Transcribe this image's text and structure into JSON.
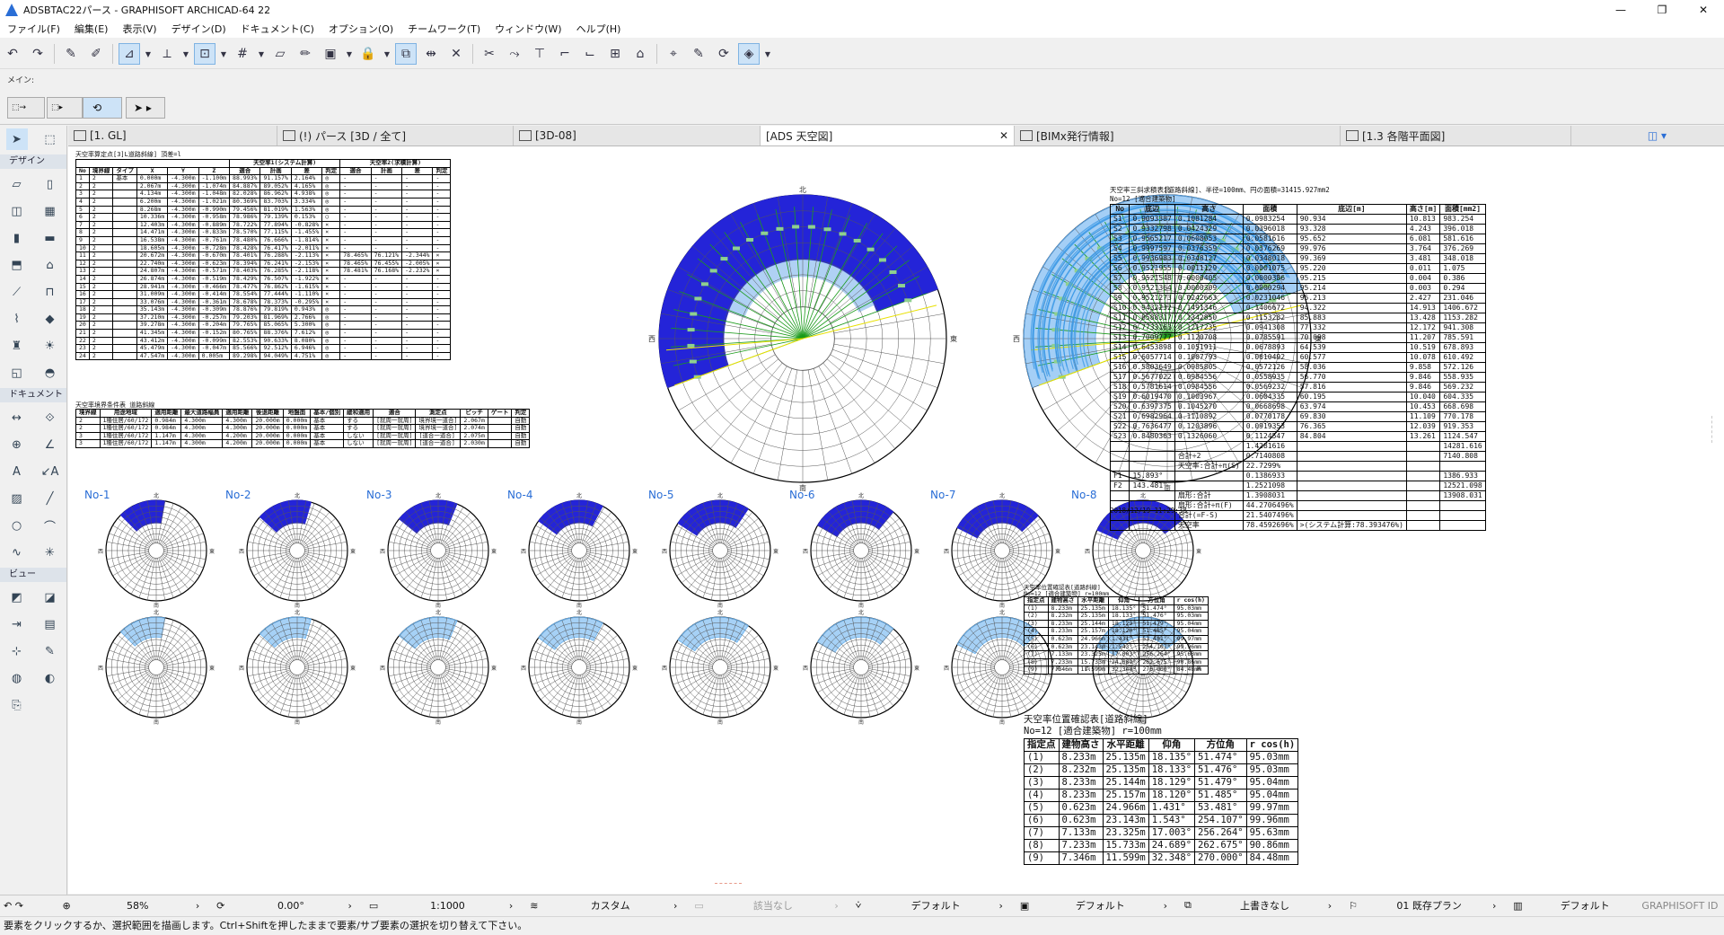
{
  "window": {
    "title": "ADSBTAC22パース - GRAPHISOFT ARCHICAD-64 22",
    "min": "—",
    "max": "❐",
    "close": "✕"
  },
  "menu": [
    "ファイル(F)",
    "編集(E)",
    "表示(V)",
    "デザイン(D)",
    "ドキュメント(C)",
    "オプション(O)",
    "チームワーク(T)",
    "ウィンドウ(W)",
    "ヘルプ(H)"
  ],
  "infobox": {
    "label": "メイン:"
  },
  "toolbox": {
    "design": "デザイン",
    "document": "ドキュメント",
    "view": "ビュー"
  },
  "tabs": [
    {
      "label": "[1. GL]",
      "active": false
    },
    {
      "label": "(!) パース [3D / 全て]",
      "active": false
    },
    {
      "label": "[3D-08]",
      "active": false
    },
    {
      "label": "[ADS 天空図]",
      "active": true
    },
    {
      "label": "[BIMx発行情報]",
      "active": false
    },
    {
      "label": "[1.3 各階平面図]",
      "active": false
    }
  ],
  "tab_close": "✕",
  "canvas": {
    "table1_title": "天空率算定点[3]L道路斜線] 頂差=l",
    "table1_group1": "天空率1(システム計算)",
    "table1_group2": "天空率2(求積計算)",
    "table1_headers": [
      "No",
      "境界線",
      "タイプ",
      "X",
      "Y",
      "Z",
      "適合",
      "計画",
      "差",
      "判定",
      "適合",
      "計画",
      "差",
      "判定"
    ],
    "table1_rows": [
      [
        "1",
        "2",
        "基本",
        "0.000m",
        "-4.300m",
        "-1.100m",
        "88.993%",
        "91.157%",
        "2.164%",
        "◎",
        "-",
        "-",
        "-",
        "-"
      ],
      [
        "2",
        "2",
        "",
        "2.067m",
        "-4.300m",
        "-1.074m",
        "84.887%",
        "89.052%",
        "4.165%",
        "◎",
        "-",
        "-",
        "-",
        "-"
      ],
      [
        "3",
        "2",
        "",
        "4.134m",
        "-4.300m",
        "-1.048m",
        "82.028%",
        "86.962%",
        "4.938%",
        "◎",
        "-",
        "-",
        "-",
        "-"
      ],
      [
        "4",
        "2",
        "",
        "6.200m",
        "-4.300m",
        "-1.021m",
        "80.369%",
        "83.703%",
        "3.334%",
        "◎",
        "-",
        "-",
        "-",
        "-"
      ],
      [
        "5",
        "2",
        "",
        "8.268m",
        "-4.300m",
        "-0.990m",
        "79.456%",
        "81.019%",
        "1.563%",
        "◎",
        "-",
        "-",
        "-",
        "-"
      ],
      [
        "6",
        "2",
        "",
        "10.336m",
        "-4.300m",
        "-0.958m",
        "78.986%",
        "79.139%",
        "0.153%",
        "○",
        "-",
        "-",
        "-",
        "-"
      ],
      [
        "7",
        "2",
        "",
        "12.403m",
        "-4.300m",
        "-0.889m",
        "78.722%",
        "77.894%",
        "-0.828%",
        "×",
        "-",
        "-",
        "-",
        "-"
      ],
      [
        "8",
        "2",
        "",
        "14.471m",
        "-4.300m",
        "-0.833m",
        "78.570%",
        "77.115%",
        "-1.455%",
        "×",
        "-",
        "-",
        "-",
        "-"
      ],
      [
        "9",
        "2",
        "",
        "16.538m",
        "-4.300m",
        "-0.761m",
        "78.480%",
        "76.666%",
        "-1.814%",
        "×",
        "-",
        "-",
        "-",
        "-"
      ],
      [
        "10",
        "2",
        "",
        "18.605m",
        "-4.300m",
        "-0.728m",
        "78.428%",
        "76.417%",
        "-2.011%",
        "×",
        "-",
        "-",
        "-",
        "-"
      ],
      [
        "11",
        "2",
        "",
        "20.672m",
        "-4.300m",
        "-0.670m",
        "78.401%",
        "76.288%",
        "-2.113%",
        "×",
        "78.465%",
        "76.121%",
        "-2.344%",
        "×"
      ],
      [
        "12",
        "2",
        "",
        "22.740m",
        "-4.300m",
        "-0.623m",
        "78.394%",
        "76.241%",
        "-2.153%",
        "×",
        "78.465%",
        "76.455%",
        "-2.005%",
        "×"
      ],
      [
        "13",
        "2",
        "",
        "24.807m",
        "-4.300m",
        "-0.571m",
        "78.403%",
        "76.285%",
        "-2.118%",
        "×",
        "78.481%",
        "76.168%",
        "-2.232%",
        "×"
      ],
      [
        "14",
        "2",
        "",
        "26.874m",
        "-4.300m",
        "-0.519m",
        "78.429%",
        "76.507%",
        "-1.922%",
        "×",
        "-",
        "-",
        "-",
        "-"
      ],
      [
        "15",
        "2",
        "",
        "28.941m",
        "-4.300m",
        "-0.466m",
        "78.477%",
        "76.862%",
        "-1.615%",
        "×",
        "-",
        "-",
        "-",
        "-"
      ],
      [
        "16",
        "2",
        "",
        "31.009m",
        "-4.300m",
        "-0.414m",
        "78.554%",
        "77.444%",
        "-1.110%",
        "×",
        "-",
        "-",
        "-",
        "-"
      ],
      [
        "17",
        "2",
        "",
        "33.076m",
        "-4.300m",
        "-0.361m",
        "78.678%",
        "78.373%",
        "-0.295%",
        "×",
        "-",
        "-",
        "-",
        "-"
      ],
      [
        "18",
        "2",
        "",
        "35.143m",
        "-4.300m",
        "-0.309m",
        "78.876%",
        "79.819%",
        "0.943%",
        "◎",
        "-",
        "-",
        "-",
        "-"
      ],
      [
        "19",
        "2",
        "",
        "37.210m",
        "-4.300m",
        "-0.257m",
        "79.203%",
        "81.969%",
        "2.766%",
        "◎",
        "-",
        "-",
        "-",
        "-"
      ],
      [
        "20",
        "2",
        "",
        "39.278m",
        "-4.300m",
        "-0.204m",
        "79.765%",
        "85.065%",
        "5.300%",
        "◎",
        "-",
        "-",
        "-",
        "-"
      ],
      [
        "21",
        "2",
        "",
        "41.345m",
        "-4.300m",
        "-0.152m",
        "80.765%",
        "88.376%",
        "7.612%",
        "◎",
        "-",
        "-",
        "-",
        "-"
      ],
      [
        "22",
        "2",
        "",
        "43.412m",
        "-4.300m",
        "-0.099m",
        "82.553%",
        "90.633%",
        "8.080%",
        "◎",
        "-",
        "-",
        "-",
        "-"
      ],
      [
        "23",
        "2",
        "",
        "45.479m",
        "-4.300m",
        "-0.047m",
        "85.566%",
        "92.512%",
        "6.946%",
        "◎",
        "-",
        "-",
        "-",
        "-"
      ],
      [
        "24",
        "2",
        "",
        "47.547m",
        "-4.300m",
        "0.005m",
        "89.298%",
        "94.049%",
        "4.751%",
        "◎",
        "-",
        "-",
        "-",
        "-"
      ]
    ],
    "table2_title": "天空率境界条件表 道路斜線",
    "table2_headers": [
      "境界線",
      "用途地域",
      "適用距離",
      "最大道路幅員",
      "適用距離",
      "後退距離",
      "地盤面",
      "基本/個別",
      "緩和適用",
      "適合",
      "測定点",
      "ピッチ",
      "ゲート",
      "判定"
    ],
    "table2_rows": [
      [
        "2",
        "1種住居/60/172",
        "0.984m",
        "4.300m",
        "4.300m",
        "20.000m",
        "0.000m",
        "基本",
        "する",
        "[就周一就周]",
        "境界境一道合]",
        "2.067m",
        "",
        "自動"
      ],
      [
        "2",
        "1種住居/60/172",
        "0.984m",
        "4.300m",
        "4.300m",
        "20.000m",
        "0.000m",
        "基本",
        "する",
        "[就周一就周]",
        "境界境一道合]",
        "2.074m",
        "",
        "自動"
      ],
      [
        "3",
        "1種住居/60/172",
        "1.147m",
        "4.300m",
        "4.200m",
        "20.000m",
        "0.000m",
        "基本",
        "しない",
        "[就周一就周]",
        "[道合一道合]",
        "2.075m",
        "",
        "自動"
      ],
      [
        "3",
        "1種住居/60/172",
        "1.147m",
        "4.300m",
        "4.200m",
        "20.000m",
        "0.000m",
        "基本",
        "しない",
        "[就周一就周]",
        "[道合一道合]",
        "2.030m",
        "",
        "自動"
      ]
    ],
    "compass": {
      "n": "北",
      "s": "南",
      "e": "東",
      "w": "西"
    },
    "small_labels": [
      "No-1",
      "No-2",
      "No-3",
      "No-4",
      "No-5",
      "No-6",
      "No-7",
      "No-8"
    ],
    "table3_title": "天空率三斜求積表[道路斜線]、半径=100mm、円の面積=31415.927mm2",
    "table3_sub": "No=12 [適合建築物]",
    "table3_headers": [
      "No",
      "底辺",
      "高さ",
      "面積",
      "底辺[m]",
      "高さ[m]",
      "面積[mm2]"
    ],
    "table3_rows": [
      [
        "S1",
        "0.9093387",
        "0.1081284",
        "0.0983254",
        "90.934",
        "10.813",
        "983.254"
      ],
      [
        "S2",
        "0.9332798",
        "0.0424329",
        "0.0396018",
        "93.328",
        "4.243",
        "396.018"
      ],
      [
        "S3",
        "0.9565217",
        "0.0608053",
        "0.0581616",
        "95.652",
        "6.081",
        "581.616"
      ],
      [
        "S4",
        "0.9997597",
        "0.0376359",
        "0.0376269",
        "99.976",
        "3.764",
        "376.269"
      ],
      [
        "S5",
        "0.9936983",
        "0.0348127",
        "0.0348018",
        "99.369",
        "3.481",
        "348.018"
      ],
      [
        "S6",
        "0.9521955",
        "0.0011129",
        "0.0001075",
        "95.220",
        "0.011",
        "1.075"
      ],
      [
        "S7",
        "0.9521548",
        "0.0000405",
        "0.0000386",
        "95.215",
        "0.004",
        "0.386"
      ],
      [
        "S8",
        "0.9521364",
        "0.0000309",
        "0.0000294",
        "95.214",
        "0.003",
        "0.294"
      ],
      [
        "S9",
        "0.9521273",
        "0.0242663",
        "0.0231046",
        "95.213",
        "2.427",
        "231.046"
      ],
      [
        "S10",
        "0.9432232",
        "0.1491346",
        "0.1406672",
        "94.322",
        "14.913",
        "1406.672"
      ],
      [
        "S11",
        "0.8588317",
        "0.1342850",
        "0.1153282",
        "85.883",
        "13.428",
        "1153.282"
      ],
      [
        "S12",
        "0.7733163",
        "0.1217235",
        "0.0941308",
        "77.332",
        "12.172",
        "941.308"
      ],
      [
        "S13",
        "0.7009777",
        "0.1120708",
        "0.0785591",
        "70.098",
        "11.207",
        "785.591"
      ],
      [
        "S14",
        "0.6453898",
        "0.1051911",
        "0.0678893",
        "64.539",
        "10.519",
        "678.893"
      ],
      [
        "S15",
        "0.6057714",
        "0.1007793",
        "0.0610492",
        "60.577",
        "10.078",
        "610.492"
      ],
      [
        "S16",
        "0.5803649",
        "0.0985805",
        "0.0572126",
        "58.036",
        "9.858",
        "572.126"
      ],
      [
        "S17",
        "0.5677022",
        "0.0984556",
        "0.0558935",
        "56.770",
        "9.846",
        "558.935"
      ],
      [
        "S18",
        "0.5781614",
        "0.0984556",
        "0.0569232",
        "57.816",
        "9.846",
        "569.232"
      ],
      [
        "S19",
        "0.6019470",
        "0.1003967",
        "0.0604335",
        "60.195",
        "10.040",
        "604.335"
      ],
      [
        "S20",
        "0.6397375",
        "0.1045270",
        "0.0668698",
        "63.974",
        "10.453",
        "668.698"
      ],
      [
        "S21",
        "0.6982964",
        "0.1110892",
        "0.0770178",
        "69.830",
        "11.109",
        "770.178"
      ],
      [
        "S22",
        "0.7636477",
        "0.1203896",
        "0.0919353",
        "76.365",
        "12.039",
        "919.353"
      ],
      [
        "S23",
        "0.8480363",
        "0.1326060",
        "0.1124547",
        "84.804",
        "13.261",
        "1124.547"
      ]
    ],
    "table3_footer": [
      [
        "",
        "",
        "",
        "1.4281616",
        "",
        "",
        "14281.616"
      ],
      [
        "",
        "",
        "合計÷2",
        "0.7140808",
        "",
        "",
        "7140.808"
      ],
      [
        "",
        "",
        "天空率:合計÷π(S)",
        "22.7299%",
        "",
        "",
        ""
      ],
      [
        "F1",
        "15.893°",
        "",
        "0.1386933",
        "",
        "",
        "1386.933"
      ],
      [
        "F2",
        "143.481°",
        "",
        "1.2521098",
        "",
        "",
        "12521.098"
      ],
      [
        "",
        "",
        "扇形:合計",
        "1.3908031",
        "",
        "",
        "13908.031"
      ],
      [
        "",
        "",
        "扇形:合計÷π(F)",
        "44.2706496%",
        "",
        "",
        ""
      ],
      [
        "",
        "",
        "合計(=F-S)",
        "21.5407496%",
        "",
        "",
        ""
      ],
      [
        "",
        "",
        "天空率",
        "78.4592696%",
        ">(システム計算:78.393476%)",
        "",
        ""
      ]
    ],
    "timestamp": "2018/12/19 11:29:38",
    "table4_title": "天空率位置確認表[道路斜線]",
    "table4_sub": "No=12 [適合建築物] r=100mm",
    "table4_headers": [
      "指定点",
      "建物高さ",
      "水平距離",
      "仰角",
      "方位角",
      "r cos(h)"
    ],
    "table4_rows": [
      [
        "(1)",
        "8.233m",
        "25.135m",
        "18.135°",
        "51.474°",
        "95.03mm"
      ],
      [
        "(2)",
        "8.232m",
        "25.135m",
        "18.133°",
        "51.476°",
        "95.03mm"
      ],
      [
        "(3)",
        "8.233m",
        "25.144m",
        "18.129°",
        "51.479°",
        "95.04mm"
      ],
      [
        "(4)",
        "8.233m",
        "25.157m",
        "18.120°",
        "51.485°",
        "95.04mm"
      ],
      [
        "(5)",
        "0.623m",
        "24.966m",
        "1.431°",
        "53.481°",
        "99.97mm"
      ],
      [
        "(6)",
        "0.623m",
        "23.143m",
        "1.543°",
        "254.107°",
        "99.96mm"
      ],
      [
        "(7)",
        "7.133m",
        "23.325m",
        "17.003°",
        "256.264°",
        "95.63mm"
      ],
      [
        "(8)",
        "7.233m",
        "15.733m",
        "24.689°",
        "262.675°",
        "90.86mm"
      ],
      [
        "(9)",
        "7.346m",
        "11.599m",
        "32.348°",
        "270.000°",
        "84.48mm"
      ]
    ]
  },
  "status": {
    "zoom": "58%",
    "angle": "0.00°",
    "scale": "1:1000",
    "layer_combo": "カスタム",
    "disabled": "該当なし",
    "pen": "デフォルト",
    "model": "デフォルト",
    "override": "上書きなし",
    "reno": "01 既存プラン",
    "dim": "デフォルト",
    "brand": "GRAPHISOFT ID"
  },
  "hint": "要素をクリックするか、選択範囲を描画します。Ctrl+Shiftを押したままで要素/サブ要素の選択を切り替えて下さい。",
  "colors": {
    "dark_blue": "#2424d8",
    "light_blue": "#3d9ae6",
    "green": "#1a9a1a",
    "yellow": "#e8e000",
    "accent": "#2a6ed6"
  }
}
